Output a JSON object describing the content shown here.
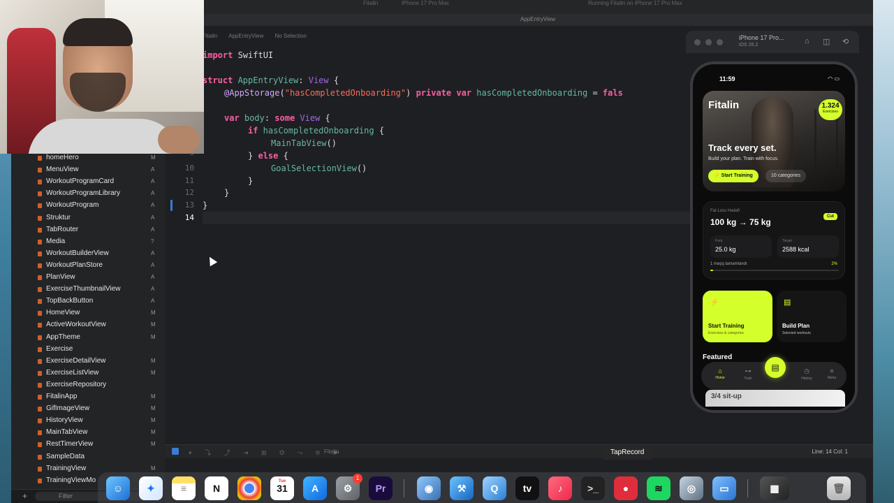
{
  "window": {
    "top_crumbs": [
      "Fitalin",
      "iPhone 17 Pro Max",
      "Running Fitalin on iPhone 17 Pro Max"
    ],
    "tab_title": "AppEntryView",
    "jump_bar": [
      "Fitalin",
      "AppEntryView",
      "No Selection"
    ]
  },
  "navigator": {
    "items": [
      {
        "label": "homeHero",
        "status": "M"
      },
      {
        "label": "MenuView",
        "status": "A"
      },
      {
        "label": "WorkoutProgramCard",
        "status": "A"
      },
      {
        "label": "WorkoutProgramLibrary",
        "status": "A"
      },
      {
        "label": "WorkoutProgram",
        "status": "A"
      },
      {
        "label": "Struktur",
        "status": "A"
      },
      {
        "label": "TabRouter",
        "status": "A"
      },
      {
        "label": "Media",
        "status": "?"
      },
      {
        "label": "WorkoutBuilderView",
        "status": "A"
      },
      {
        "label": "WorkoutPlanStore",
        "status": "A"
      },
      {
        "label": "PlanView",
        "status": "A"
      },
      {
        "label": "ExerciseThumbnailView",
        "status": "A"
      },
      {
        "label": "TopBackButton",
        "status": "A"
      },
      {
        "label": "HomeView",
        "status": "M"
      },
      {
        "label": "ActiveWorkoutView",
        "status": "M"
      },
      {
        "label": "AppTheme",
        "status": "M"
      },
      {
        "label": "Exercise",
        "status": ""
      },
      {
        "label": "ExerciseDetailView",
        "status": "M"
      },
      {
        "label": "ExerciseListView",
        "status": "M"
      },
      {
        "label": "ExerciseRepository",
        "status": ""
      },
      {
        "label": "FitalinApp",
        "status": "M"
      },
      {
        "label": "GifImageView",
        "status": "M"
      },
      {
        "label": "HistoryView",
        "status": "M"
      },
      {
        "label": "MainTabView",
        "status": "M"
      },
      {
        "label": "RestTimerView",
        "status": "M"
      },
      {
        "label": "SampleData",
        "status": ""
      },
      {
        "label": "TrainingView",
        "status": "M"
      },
      {
        "label": "TrainingViewMo",
        "status": ""
      }
    ],
    "filter_placeholder": "Filter"
  },
  "editor": {
    "line_numbers": [
      "9",
      "10",
      "11",
      "12",
      "13",
      "14"
    ],
    "lines": {
      "l1_kw": "import",
      "l1_rest": " SwiftUI",
      "l3_kw": "struct",
      "l3_name": " AppEntryView",
      "l3_colon": ": ",
      "l3_type": "View",
      "l3_brace": " {",
      "l4_attr": "@AppStorage",
      "l4_paren": "(",
      "l4_str": "\"hasCompletedOnboarding\"",
      "l4_close": ") ",
      "l4_kw1": "private",
      "l4_sp": " ",
      "l4_kw2": "var",
      "l4_var": " hasCompletedOnboarding",
      "l4_eq": " = ",
      "l4_val": "fals",
      "l6_kw": "var",
      "l6_name": " body",
      "l6_colon": ": ",
      "l6_kw2": "some",
      "l6_type": " View",
      "l6_brace": " {",
      "l7_kw": "if",
      "l7_var": " hasCompletedOnboarding",
      "l7_brace": " {",
      "l8_fn": "MainTabView",
      "l8_paren": "()",
      "l9_close": "} ",
      "l9_kw": "else",
      "l9_brace": " {",
      "l10_fn": "GoalSelectionView",
      "l10_paren": "()",
      "l11": "}",
      "l12": "}",
      "l13": "}"
    }
  },
  "statusbar": {
    "scheme": "Fitalin",
    "line_col": "Line: 14  Col: 1",
    "tap_record": "TapRecord"
  },
  "simulator": {
    "device": "iPhone 17 Pro...",
    "os": "iOS 26.2",
    "app": {
      "time": "11:59",
      "logo": "Fitalin",
      "exercise_count": "1.324",
      "exercise_count_label": "Exercises",
      "hero_title": "Track every set.",
      "hero_subtitle": "Build your plan. Train with focus.",
      "start_training_btn": "Start Training",
      "categories_chip": "10 categories",
      "goal_label": "Fat Loss Hədəfi",
      "goal_value": "100 kg → 75 kg",
      "goal_tag": "Cut",
      "stat1_key": "Fərq",
      "stat1_val": "25.0 kg",
      "stat2_key": "Target",
      "stat2_val": "2588 kcal",
      "progress_label": "1 məşq tamamlandı",
      "progress_pct": "2%",
      "progress_value": 2,
      "action1_title": "Start Training",
      "action1_sub": "Exercises & categories",
      "action2_title": "Build Plan",
      "action2_sub": "Selected workouts",
      "featured": "Featured",
      "tabs": [
        "Home",
        "Train",
        "History",
        "Menu"
      ],
      "featured_card": "3/4 sit-up"
    }
  },
  "dock": {
    "calendar_day": "31",
    "calendar_month": "Tue",
    "settings_badge": "1",
    "apps": [
      "Finder",
      "Safari",
      "Notes",
      "Notion",
      "Chrome",
      "Calendar",
      "App Store",
      "System Settings",
      "Premiere Pro",
      "Finder Disk",
      "Xcode",
      "QuickTime",
      "Apple TV",
      "Music",
      "Terminal",
      "Recorder",
      "Spotify",
      "Instruments",
      "Files",
      "Screenshot",
      "Trash"
    ]
  }
}
